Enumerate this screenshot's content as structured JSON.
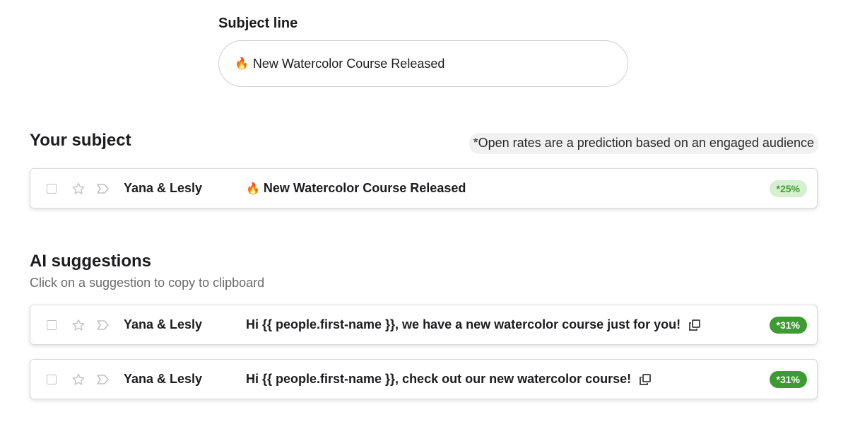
{
  "subject_input": {
    "label": "Subject line",
    "emoji": "🔥",
    "value": "New Watercolor Course Released"
  },
  "your_subject": {
    "title": "Your subject",
    "note": "*Open rates are a prediction based on an engaged audience",
    "row": {
      "sender": "Yana & Lesly",
      "emoji": "🔥",
      "subject": "New Watercolor Course Released",
      "rate": "*25%"
    }
  },
  "ai_suggestions": {
    "title": "AI suggestions",
    "hint": "Click on a suggestion to copy to clipboard",
    "rows": [
      {
        "sender": "Yana & Lesly",
        "subject": "Hi {{ people.first-name }}, we have a new watercolor course just for you!",
        "rate": "*31%"
      },
      {
        "sender": "Yana & Lesly",
        "subject": "Hi {{ people.first-name }}, check out our new watercolor course!",
        "rate": "*31%"
      }
    ]
  },
  "icons": {
    "checkbox": "checkbox-icon",
    "star": "star-icon",
    "label": "label-tag-icon",
    "copy": "copy-icon"
  },
  "colors": {
    "badge_light_bg": "#d4f0cf",
    "badge_light_text": "#3f9a34",
    "badge_strong_bg": "#3e9a33",
    "badge_strong_text": "#ffffff"
  }
}
